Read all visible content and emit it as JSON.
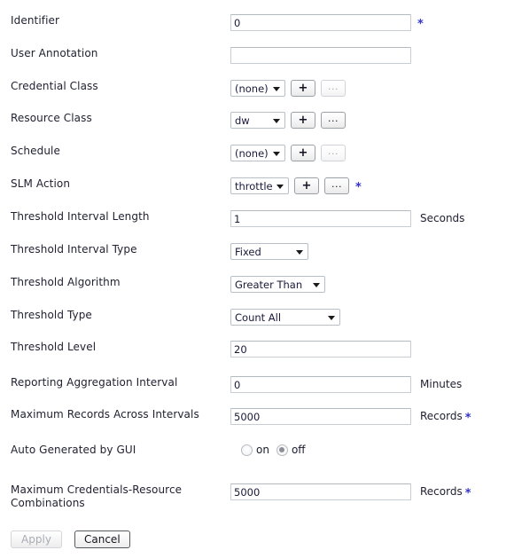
{
  "form": {
    "rows": [
      {
        "label": "Identifier",
        "type": "text",
        "value": "0",
        "required": true
      },
      {
        "label": "User Annotation",
        "type": "text",
        "value": "",
        "required": false
      },
      {
        "label": "Credential Class",
        "type": "select-buttons",
        "value": "(none)",
        "add_label": "+",
        "more_label": "...",
        "add_enabled": true,
        "more_enabled": false,
        "required": false
      },
      {
        "label": "Resource Class",
        "type": "select-buttons",
        "value": "dw",
        "add_label": "+",
        "more_label": "...",
        "add_enabled": true,
        "more_enabled": true,
        "required": false
      },
      {
        "label": "Schedule",
        "type": "select-buttons",
        "value": "(none)",
        "add_label": "+",
        "more_label": "...",
        "add_enabled": true,
        "more_enabled": false,
        "required": false
      },
      {
        "label": "SLM Action",
        "type": "select-buttons",
        "value": "throttle",
        "add_label": "+",
        "more_label": "...",
        "add_enabled": true,
        "more_enabled": true,
        "required": true
      },
      {
        "label": "Threshold Interval Length",
        "type": "text",
        "value": "1",
        "unit": "Seconds",
        "required": false
      },
      {
        "label": "Threshold Interval Type",
        "type": "select",
        "value": "Fixed",
        "required": false
      },
      {
        "label": "Threshold Algorithm",
        "type": "select",
        "value": "Greater Than",
        "required": false
      },
      {
        "label": "Threshold Type",
        "type": "select",
        "value": "Count All",
        "required": false
      },
      {
        "label": "Threshold Level",
        "type": "text",
        "value": "20",
        "required": false
      },
      {
        "label": "Reporting Aggregation Interval",
        "type": "text",
        "value": "0",
        "unit": "Minutes",
        "required": false
      },
      {
        "label": "Maximum Records Across Intervals",
        "type": "text",
        "value": "5000",
        "unit": "Records",
        "unit_required": true,
        "required": false
      },
      {
        "label": "Auto Generated by GUI",
        "type": "radio",
        "options": [
          "on",
          "off"
        ],
        "selected": "off",
        "required": false
      },
      {
        "label": "Maximum Credentials-Resource Combinations",
        "label_line1": "Maximum Credentials-Resource",
        "label_line2": "Combinations",
        "type": "text",
        "value": "5000",
        "unit": "Records",
        "unit_required": true,
        "required": false
      }
    ],
    "actions": {
      "apply_label": "Apply",
      "cancel_label": "Cancel",
      "apply_enabled": false,
      "cancel_enabled": true
    },
    "required_marker": "*",
    "colors": {
      "required_marker": "#3333cc",
      "label_text": "#222232",
      "input_border": "#c8cdd4",
      "select_border": "#b9bfc6",
      "page_background": "#ffffff"
    }
  }
}
